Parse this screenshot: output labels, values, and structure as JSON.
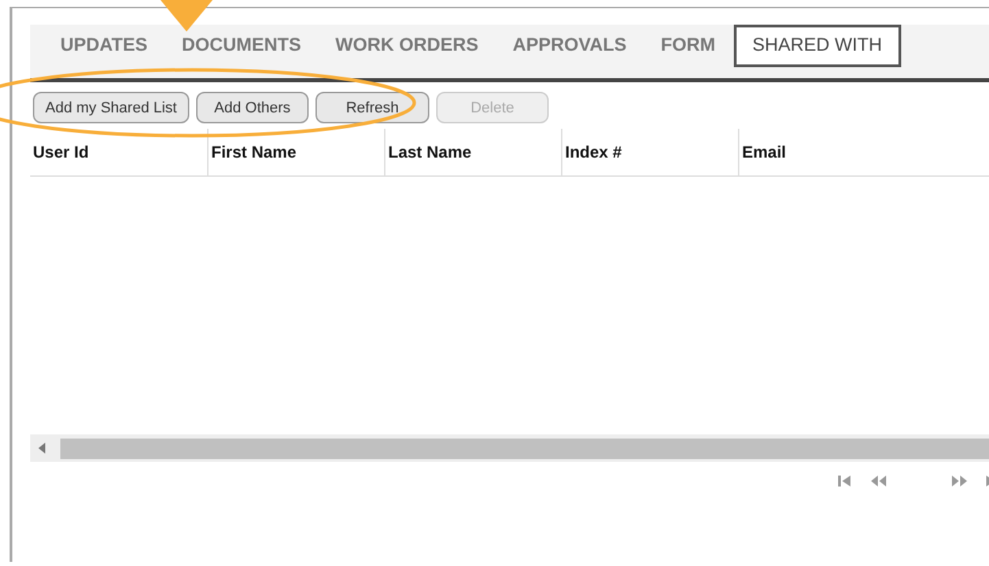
{
  "tabs": [
    {
      "label": "UPDATES",
      "selected": false
    },
    {
      "label": "DOCUMENTS",
      "selected": false
    },
    {
      "label": "WORK ORDERS",
      "selected": false
    },
    {
      "label": "APPROVALS",
      "selected": false
    },
    {
      "label": "FORM",
      "selected": false
    },
    {
      "label": "SHARED WITH",
      "selected": true
    }
  ],
  "buttons": [
    {
      "label": "Add my Shared List",
      "disabled": false
    },
    {
      "label": "Add Others",
      "disabled": false
    },
    {
      "label": "Refresh",
      "disabled": false
    },
    {
      "label": "Delete",
      "disabled": true
    }
  ],
  "table": {
    "columns": [
      "User Id",
      "First Name",
      "Last Name",
      "Index #",
      "Email"
    ]
  }
}
